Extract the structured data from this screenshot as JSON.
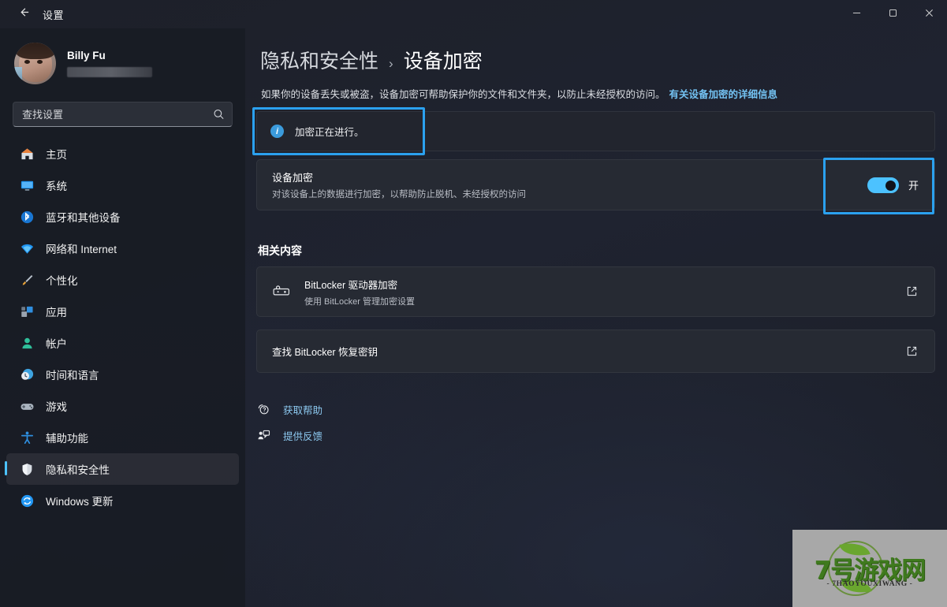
{
  "window": {
    "title": "设置",
    "back_icon": "arrow-left-icon",
    "minimize_label": "─",
    "maximize_label": "❐",
    "close_label": "✕"
  },
  "sidebar": {
    "profile": {
      "name": "Billy Fu",
      "email": ""
    },
    "search": {
      "placeholder": "查找设置",
      "value": "",
      "icon": "search-icon"
    },
    "items": [
      {
        "label": "主页",
        "icon": "home-icon",
        "selected": false
      },
      {
        "label": "系统",
        "icon": "system-icon",
        "selected": false
      },
      {
        "label": "蓝牙和其他设备",
        "icon": "bluetooth-icon",
        "selected": false
      },
      {
        "label": "网络和 Internet",
        "icon": "wifi-icon",
        "selected": false
      },
      {
        "label": "个性化",
        "icon": "brush-icon",
        "selected": false
      },
      {
        "label": "应用",
        "icon": "apps-icon",
        "selected": false
      },
      {
        "label": "帐户",
        "icon": "account-icon",
        "selected": false
      },
      {
        "label": "时间和语言",
        "icon": "clock-globe-icon",
        "selected": false
      },
      {
        "label": "游戏",
        "icon": "gamepad-icon",
        "selected": false
      },
      {
        "label": "辅助功能",
        "icon": "accessibility-icon",
        "selected": false
      },
      {
        "label": "隐私和安全性",
        "icon": "shield-icon",
        "selected": true
      },
      {
        "label": "Windows 更新",
        "icon": "update-icon",
        "selected": false
      }
    ]
  },
  "main": {
    "breadcrumb": {
      "parent": "隐私和安全性",
      "separator": "›",
      "current": "设备加密"
    },
    "description": {
      "text": "如果你的设备丢失或被盗，设备加密可帮助保护你的文件和文件夹，以防止未经授权的访问。",
      "link": "有关设备加密的详细信息"
    },
    "banner": {
      "icon": "info-icon",
      "text": "加密正在进行。"
    },
    "encryption_row": {
      "title": "设备加密",
      "subtitle": "对该设备上的数据进行加密，以帮助防止脱机、未经授权的访问",
      "toggle_state": "on",
      "toggle_label": "开"
    },
    "related": {
      "section_title": "相关内容",
      "items": [
        {
          "title": "BitLocker 驱动器加密",
          "subtitle": "使用 BitLocker 管理加密设置",
          "icon": "drive-lock-icon",
          "action_icon": "external-link-icon"
        },
        {
          "title": "查找 BitLocker 恢复密钥",
          "subtitle": "",
          "icon": "",
          "action_icon": "external-link-icon"
        }
      ]
    },
    "links": [
      {
        "label": "获取帮助",
        "icon": "help-icon"
      },
      {
        "label": "提供反馈",
        "icon": "feedback-icon"
      }
    ]
  },
  "watermark": {
    "main": "7号游戏网",
    "sub": "- 7HAOYOUXIWANG -"
  },
  "colors": {
    "accent": "#4cc2ff",
    "highlight_border": "#2ba1ef",
    "link": "#8cc8ef",
    "background": "#1d2029",
    "card": "#262a33"
  }
}
